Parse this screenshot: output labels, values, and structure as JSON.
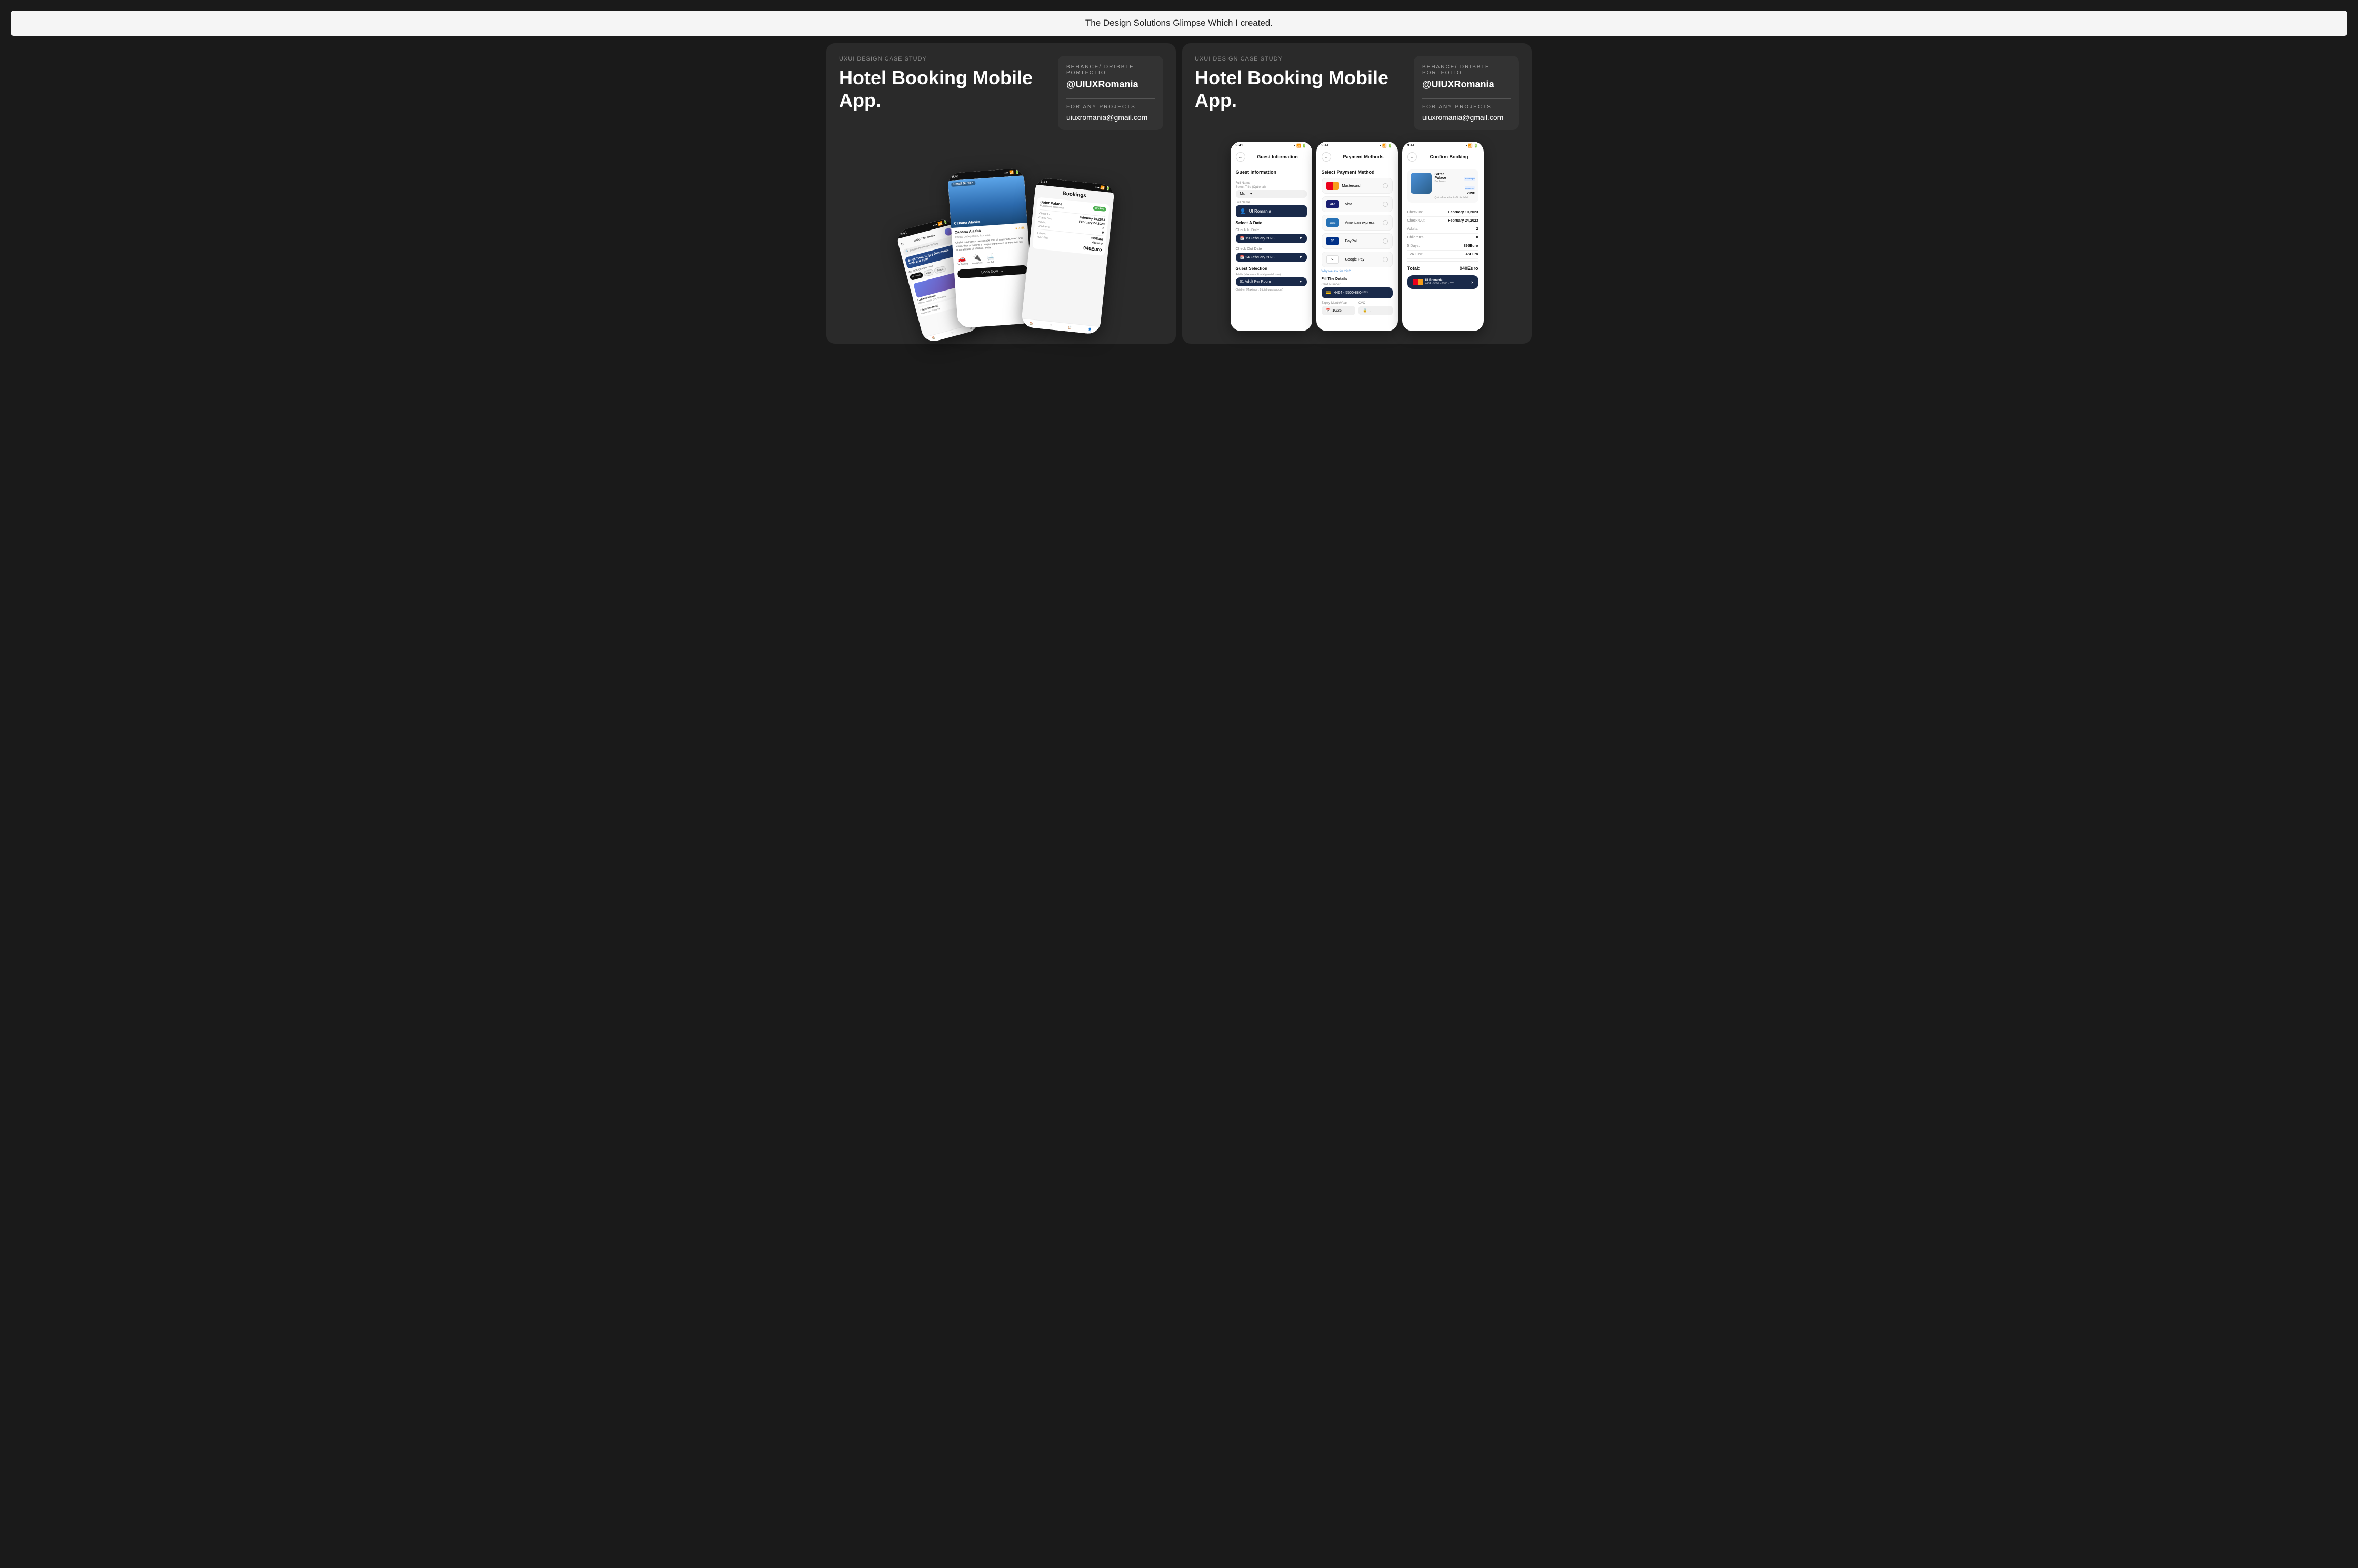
{
  "page": {
    "title": "The Design Solutions Glimpse Which I created."
  },
  "left_panel": {
    "case_study_label": "UXUI Design Case Study",
    "title": "Hotel Booking Mobile App.",
    "behance_label": "BEHANCE/ DRIBBLE PORTFOLIO",
    "username": "@UIUXRomania",
    "projects_label": "FOR ANY PROJECTS",
    "email": "uiuxromania@gmail.com"
  },
  "right_panel": {
    "case_study_label": "UXUI Design Case Study",
    "title": "Hotel Booking Mobile App.",
    "behance_label": "BEHANCE/ DRIBBLE PORTFOLIO",
    "username": "@UIUXRomania",
    "projects_label": "FOR ANY PROJECTS",
    "email": "uiuxromania@gmail.com"
  },
  "phone_home": {
    "status_time": "9:41",
    "greeting": "Hello, UIRomania",
    "search_placeholder": "Search Any Place to Stay",
    "banner_text": "Book Now, Enjoy Discounts with our app!",
    "acc_type_label": "Accommodation Type",
    "acc_chips": [
      "All Hotels",
      "Villas",
      "Resort"
    ],
    "hotel1_name": "Cabana Alaska",
    "hotel1_rating": "4.8k",
    "hotel1_loc": "Rânca, Județul Gorj, Romania",
    "hotel2_name": "Christina Hotel",
    "hotel2_loc": "Bucharest, Romania",
    "hotel2_price": "299€",
    "nav_items": [
      "Home",
      "♡",
      "☰"
    ]
  },
  "phone_detail": {
    "status_time": "9:41",
    "screen_label": "Detail Screen",
    "hotel_name": "Cabana Alaska",
    "hotel_rating": "4.8k",
    "hotel_loc": "Rânca, Județul Gorj, Romania",
    "description": "Chalet is a rustic chalet made sole of materials, wood and stone, thus providing a unique experience in mountain life at an altitude of 1600 m, while...",
    "amenities": [
      "Car Parking",
      "Appliances",
      "Hot Tub"
    ],
    "book_btn": "Book Now"
  },
  "phone_bookings": {
    "status_time": "9:41",
    "screen_title": "Bookings",
    "hotel_name": "Suter Palace",
    "hotel_loc": "Bucharest, Romania",
    "hotel_badge": "Booked",
    "check_in_label": "Check In:",
    "check_in_val": "February 19,2023",
    "check_out_label": "Check Out:",
    "check_out_val": "February 24,2023",
    "adults_label": "Adults:",
    "adults_val": "2",
    "children_label": "Children's:",
    "children_val": "0",
    "days_label": "5 Days:",
    "days_val": "895Euro",
    "tva_label": "TVA 10%:",
    "tva_val": "45Euro",
    "total_label": "940Euro"
  },
  "phone_guest": {
    "status_time": "9:41",
    "screen_title": "Guest Information",
    "section_title": "Guest Information",
    "full_name_label": "Full Name",
    "title_label": "Select Title (Optional)",
    "title_val": "Mr.",
    "name_label": "Full Name",
    "name_val": "UI Romania",
    "select_date_label": "Select A Date",
    "check_in_label": "Check In Date",
    "check_in_val": "19 February 2023",
    "check_out_label": "Check Out Date",
    "check_out_val": "24 February 2023",
    "guest_sel_label": "Guest Selection",
    "adults_label": "Adults (Maximum: 8 total guests/room)",
    "adults_val": "01 Adult Per Room",
    "children_label": "Children (Maximum: 8 total guests/room)"
  },
  "phone_payment": {
    "status_time": "9:41",
    "screen_title": "Payment Methods",
    "section_title": "Select Payment Method",
    "methods": [
      "Mastercard",
      "Visa",
      "American express",
      "PayPal",
      "Google Pay"
    ],
    "why_ask": "Why we ask for this?",
    "fill_details": "Fill The Details",
    "card_number_label": "Card Number",
    "card_number_val": "4464 - 5500-880-****",
    "expiry_label": "Expiry Month/Year",
    "expiry_val": "10/25",
    "cvc_label": "CVC",
    "cvc_val": "..."
  },
  "phone_confirm": {
    "status_time": "9:41",
    "screen_title": "Confirm Booking",
    "hotel_name": "Suter Palace",
    "hotel_badge": "Booking in progress",
    "hotel_loc": "Bucharest",
    "hotel_price": "239€",
    "hotel_desc": "Qvfusdum et aut officiis debit...",
    "check_in_label": "Check In:",
    "check_in_val": "February 19,2023",
    "check_out_label": "Check Out:",
    "check_out_val": "February 24,2023",
    "adults_label": "Adults:",
    "adults_val": "2",
    "children_label": "Children's:",
    "children_val": "0",
    "days_label": "5 Days:",
    "days_val": "895Euro",
    "tva_label": "TVA 10%:",
    "tva_val": "45Euro",
    "total_label": "Total:",
    "total_val": "940Euro",
    "pay_user": "UI Romania",
    "pay_card": "4464 - 5500 - 8800 - ****"
  }
}
